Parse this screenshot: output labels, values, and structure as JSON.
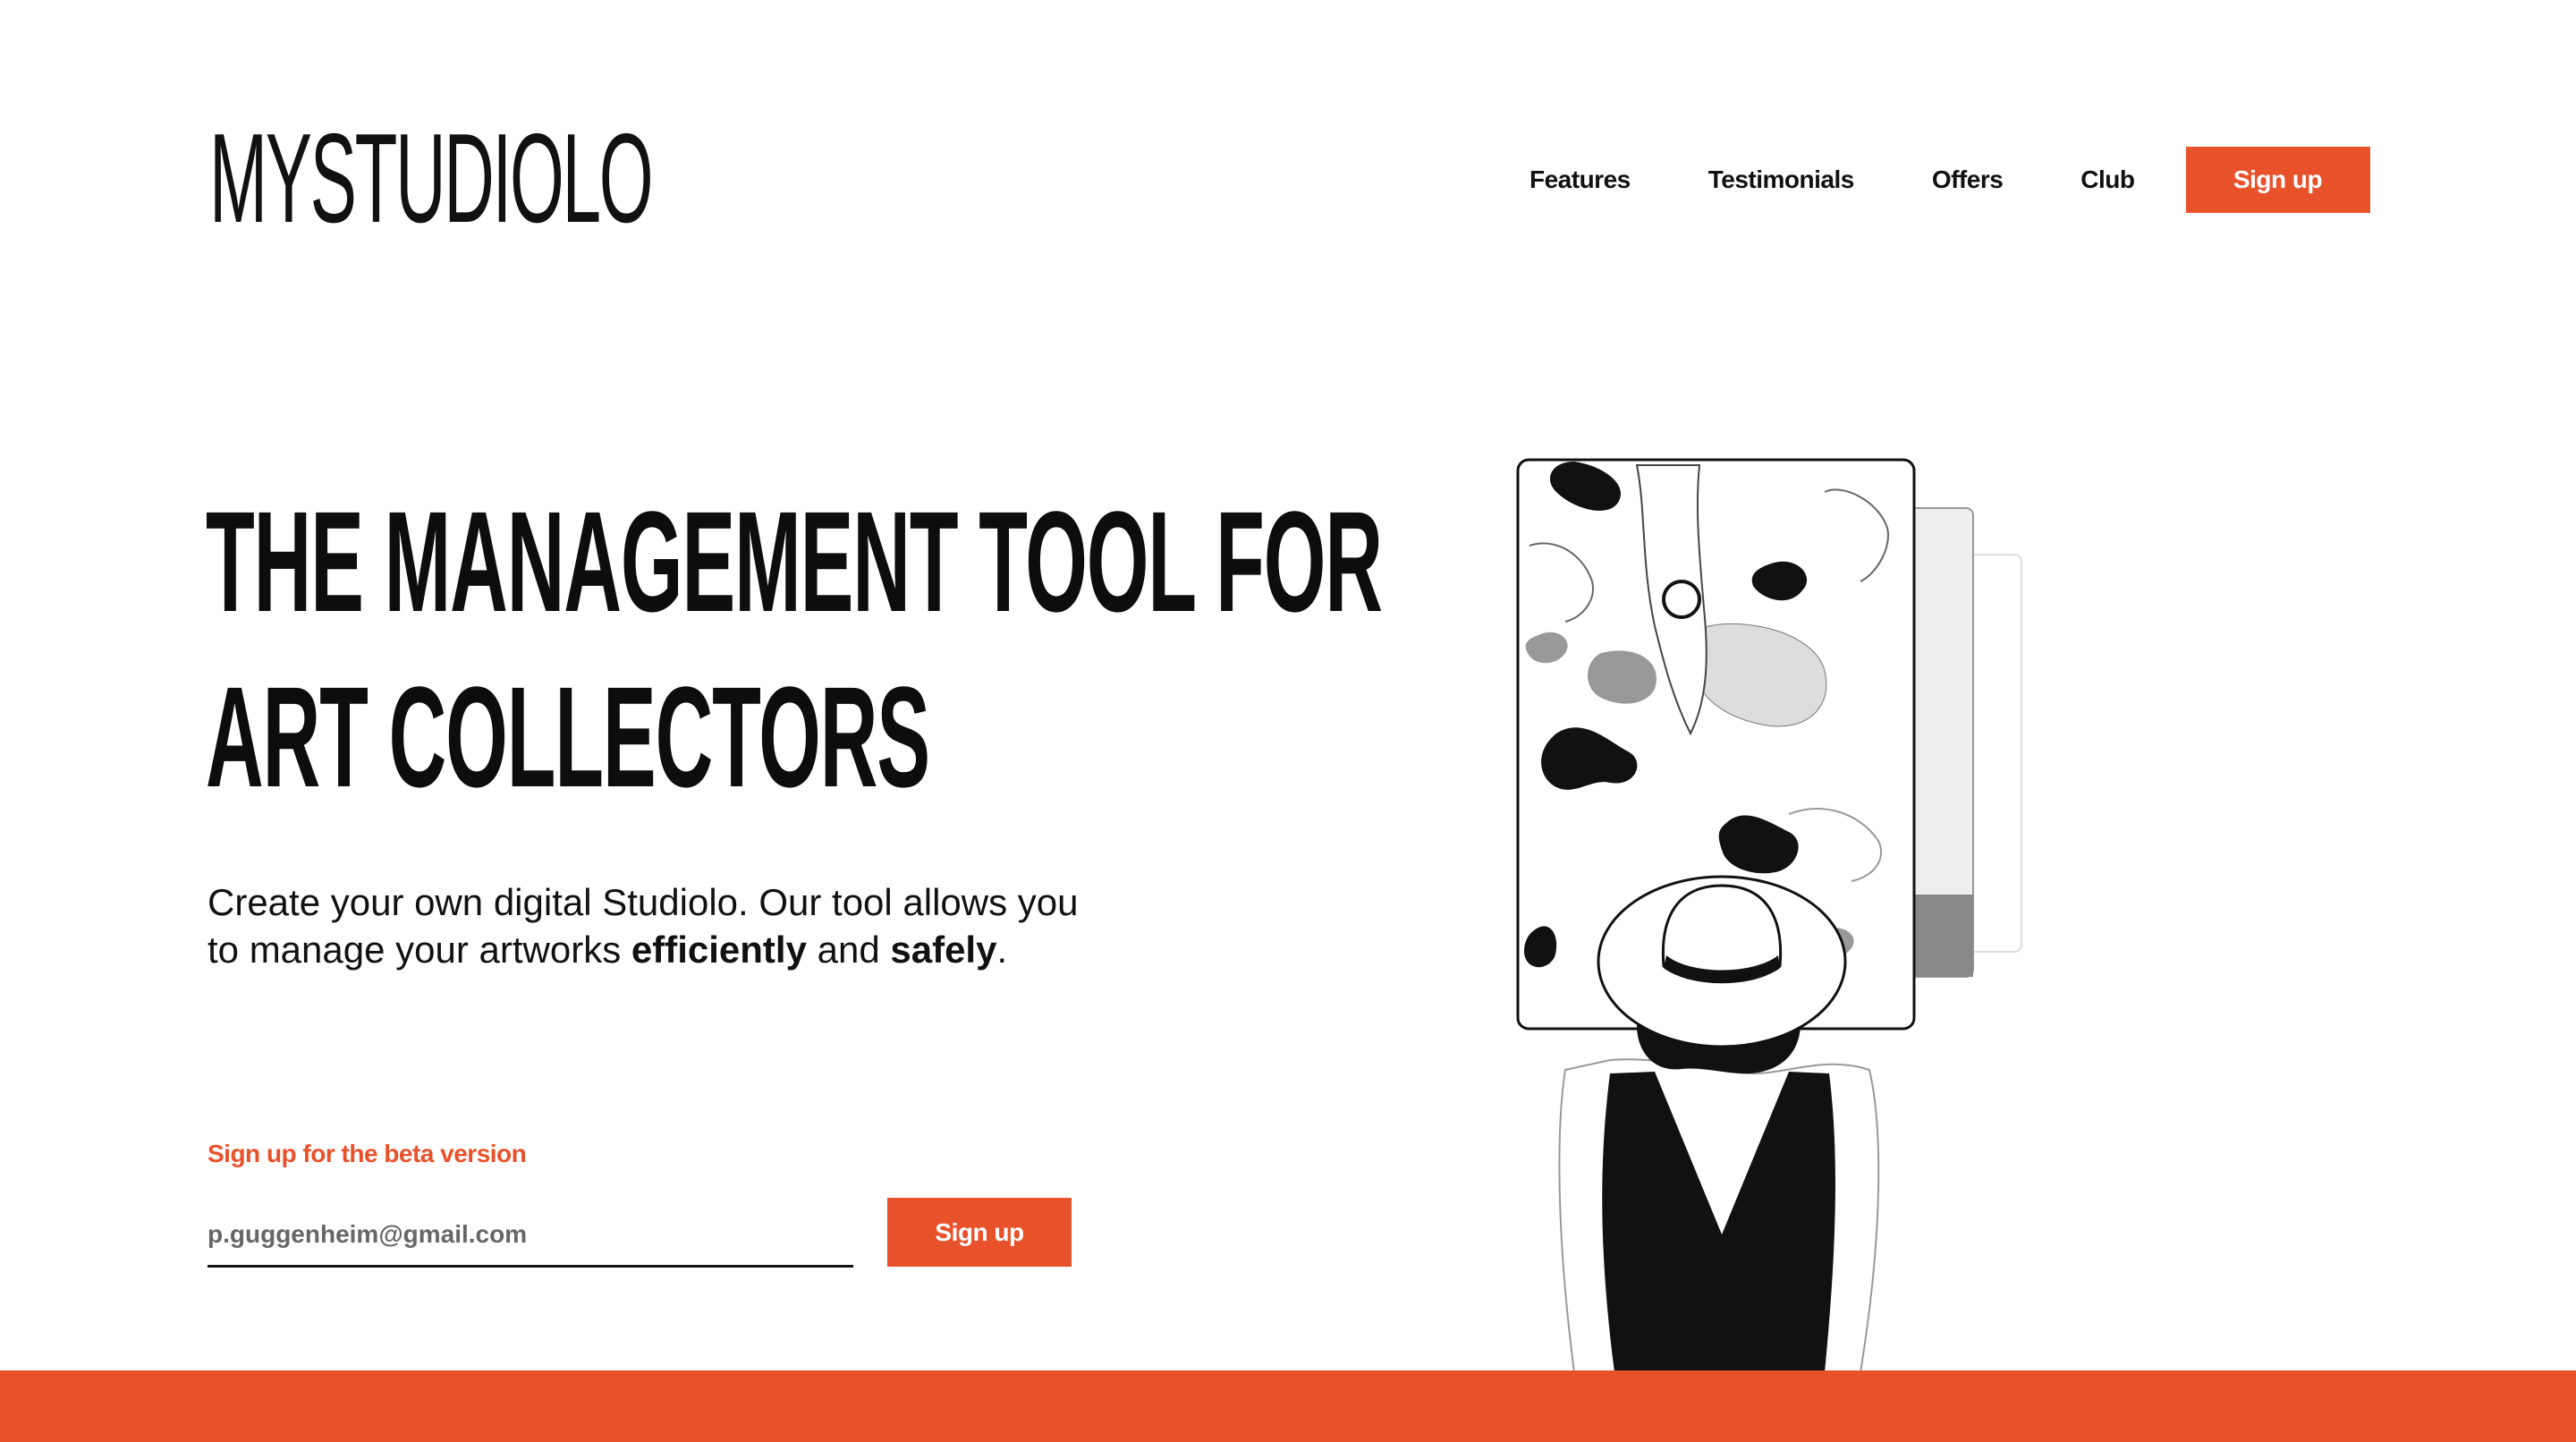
{
  "brand": {
    "logo_text": "MYSTUDIOLO"
  },
  "nav": {
    "items": [
      "Features",
      "Testimonials",
      "Offers",
      "Club"
    ],
    "signup_label": "Sign up"
  },
  "hero": {
    "headline_line1": "THE MANAGEMENT TOOL FOR",
    "headline_line2": "ART COLLECTORS",
    "lead_part1": "Create your own digital Studiolo. Our tool allows you to manage your artworks ",
    "lead_bold1": "efficiently",
    "lead_part2": " and ",
    "lead_bold2": "safely",
    "lead_part3": "."
  },
  "form": {
    "label": "Sign up for the beta version",
    "email_placeholder": "p.guggenheim@gmail.com",
    "submit_label": "Sign up"
  },
  "colors": {
    "accent": "#e8522b",
    "text": "#111111",
    "background": "#ffffff"
  },
  "illustration": {
    "name": "person-in-hat-viewing-artwork"
  }
}
